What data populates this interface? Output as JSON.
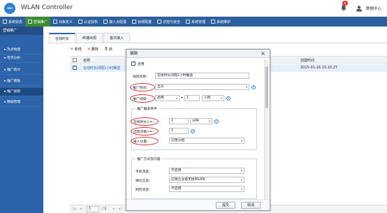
{
  "header": {
    "logo_text": "H3C",
    "title": "WLAN Controller",
    "alarm_count": "6",
    "user": "数据中心"
  },
  "nav": [
    {
      "label": "系统状态",
      "icon": "monitor-icon"
    },
    {
      "label": "营销推广",
      "icon": "chart-icon",
      "active": true
    },
    {
      "label": "对象定义",
      "icon": "users-icon"
    },
    {
      "label": "认证授权",
      "icon": "user-icon"
    },
    {
      "label": "接入点配置",
      "icon": "access-point-icon"
    },
    {
      "label": "射频配置",
      "icon": "radio-icon"
    },
    {
      "label": "访控与安全",
      "icon": "shield-icon"
    },
    {
      "label": "系统管理",
      "icon": "gear-icon"
    },
    {
      "label": "系统维护",
      "icon": "wrench-icon"
    }
  ],
  "sidebar": {
    "title": "营销推广",
    "items": [
      {
        "label": "热点地图"
      },
      {
        "label": "客流分析"
      },
      {
        "label": "推广统计"
      },
      {
        "label": "推广模板"
      },
      {
        "label": "推广规则",
        "active": true
      },
      {
        "label": "数据管理"
      }
    ]
  },
  "content": {
    "tabs": [
      "在线时长",
      "终端出现",
      "首次接入"
    ],
    "toolbar": {
      "new": "新增",
      "delete": "删除",
      "enable": "启"
    },
    "columns": {
      "name": "名称",
      "created": "创建时间"
    },
    "rows": [
      {
        "name": "在线时长间隔1小时推送",
        "created": "2015-01-16 15:10:27"
      }
    ],
    "pager": {
      "page": "1",
      "total": "/ 1"
    }
  },
  "dialog": {
    "title": "编辑",
    "enabled_label": "启用",
    "rule_name_label": "规则名称：",
    "rule_name_value": "在线时长间隔1小时推送",
    "push_time_label": "推广时间：",
    "push_time_value": "全天",
    "push_interval_label": "推广间隔：",
    "push_interval_mode": "启用",
    "push_interval_value": "1",
    "push_interval_unit": "小时",
    "trigger_legend": "推广触发条件",
    "online_time_label": "在线时长>=：",
    "online_time_value": "1",
    "online_time_unit": "分钟",
    "appear_count_label": "出现次数>=：",
    "appear_count_value": "1",
    "access_location_label": "接入位置：",
    "access_location_value": "信锐分组",
    "method_legend": "推广方式及内容",
    "sms_label": "手机消息：",
    "sms_value": "不启用",
    "wechat_label": "微信信息：",
    "wechat_value": "信锐企业级无线WLAN",
    "web_label": "网页消息：",
    "web_value": "不启用",
    "submit": "提交",
    "cancel": "取消"
  },
  "colors": {
    "nav_bg": "#2b5f9e",
    "nav_active": "#3c8a36",
    "sidebar_bg": "#2d63a8",
    "highlight_oval": "#d63030"
  }
}
